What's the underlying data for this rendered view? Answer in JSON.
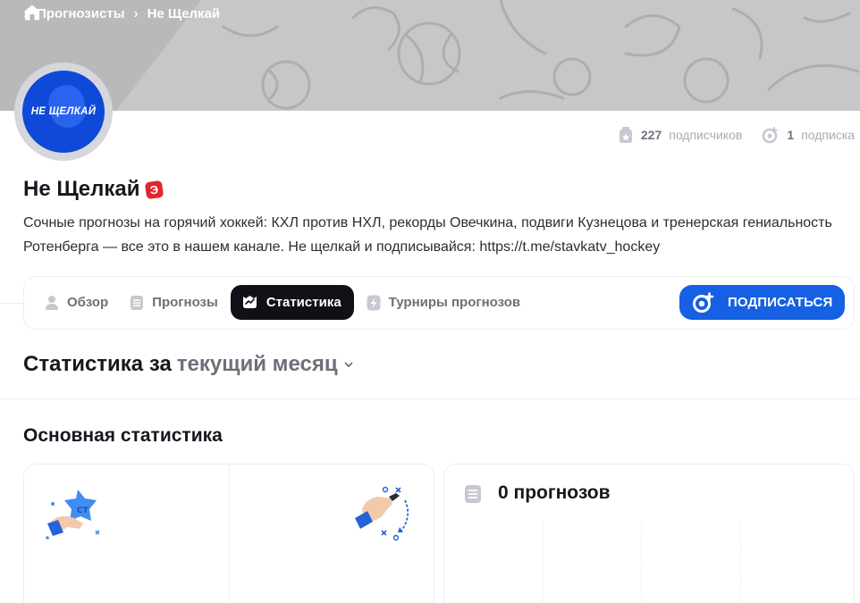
{
  "breadcrumb": {
    "items": [
      "Прогнозисты",
      "Не Щелкай"
    ]
  },
  "profile": {
    "avatar_text": "НЕ ЩЕЛКАЙ",
    "name": "Не Щелкай",
    "badge": "Э",
    "description": "Сочные прогнозы на горячий хоккей: КХЛ против НХЛ, рекорды Овечкина, подвиги Кузнецова и тренерская гениальность Ротенберга — все это в нашем канале. Не щелкай и подписывайся: https://t.me/stavkatv_hockey"
  },
  "stats": {
    "subscribers_count": "227",
    "subscribers_label": "подписчиков",
    "subscriptions_count": "1",
    "subscriptions_label": "подписка"
  },
  "nav": {
    "tabs": [
      {
        "label": "Обзор",
        "icon": "user-icon"
      },
      {
        "label": "Прогнозы",
        "icon": "list-icon"
      },
      {
        "label": "Статистика",
        "icon": "stats-icon",
        "active": true
      },
      {
        "label": "Турниры прогнозов",
        "icon": "lightning-icon"
      }
    ],
    "subscribe_label": "ПОДПИСАТЬСЯ"
  },
  "section": {
    "period_prefix": "Статистика за",
    "period_selected": "текущий месяц",
    "main_heading": "Основная статистика",
    "forecasts_count": "0 прогнозов"
  },
  "colors": {
    "accent": "#1560e3",
    "active_tab": "#0f1116",
    "badge": "#e2252d",
    "banner": "#b9b9bb"
  }
}
